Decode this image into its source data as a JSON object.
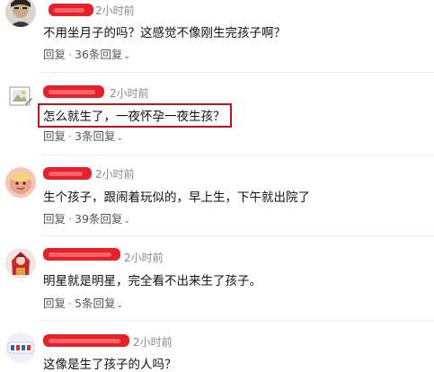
{
  "comments": [
    {
      "time": "2小时前",
      "text": "不用坐月子的吗？这感觉不像刚生完孩子啊？",
      "reply_label": "回复",
      "separator": "·",
      "replies_label": "36条回复",
      "chevron": "⌄"
    },
    {
      "time": "2小时前",
      "text": "怎么就生了，一夜怀孕一夜生孩？",
      "reply_label": "回复",
      "separator": "·",
      "replies_label": "3条回复",
      "chevron": "⌄"
    },
    {
      "time": "2小时前",
      "text": "生个孩子，跟闹着玩似的，早上生，下午就出院了",
      "reply_label": "回复",
      "separator": "·",
      "replies_label": "39条回复",
      "chevron": "⌄"
    },
    {
      "time": "2小时前",
      "text": "明星就是明星，完全看不出来生了孩子。",
      "reply_label": "回复",
      "separator": "·",
      "replies_label": "5条回复",
      "chevron": "⌄"
    },
    {
      "time": "2小时前",
      "text": "这像是生了孩子的人吗？"
    }
  ],
  "colors": {
    "redaction": "#e8202a",
    "highlight_box": "#c0141c"
  }
}
